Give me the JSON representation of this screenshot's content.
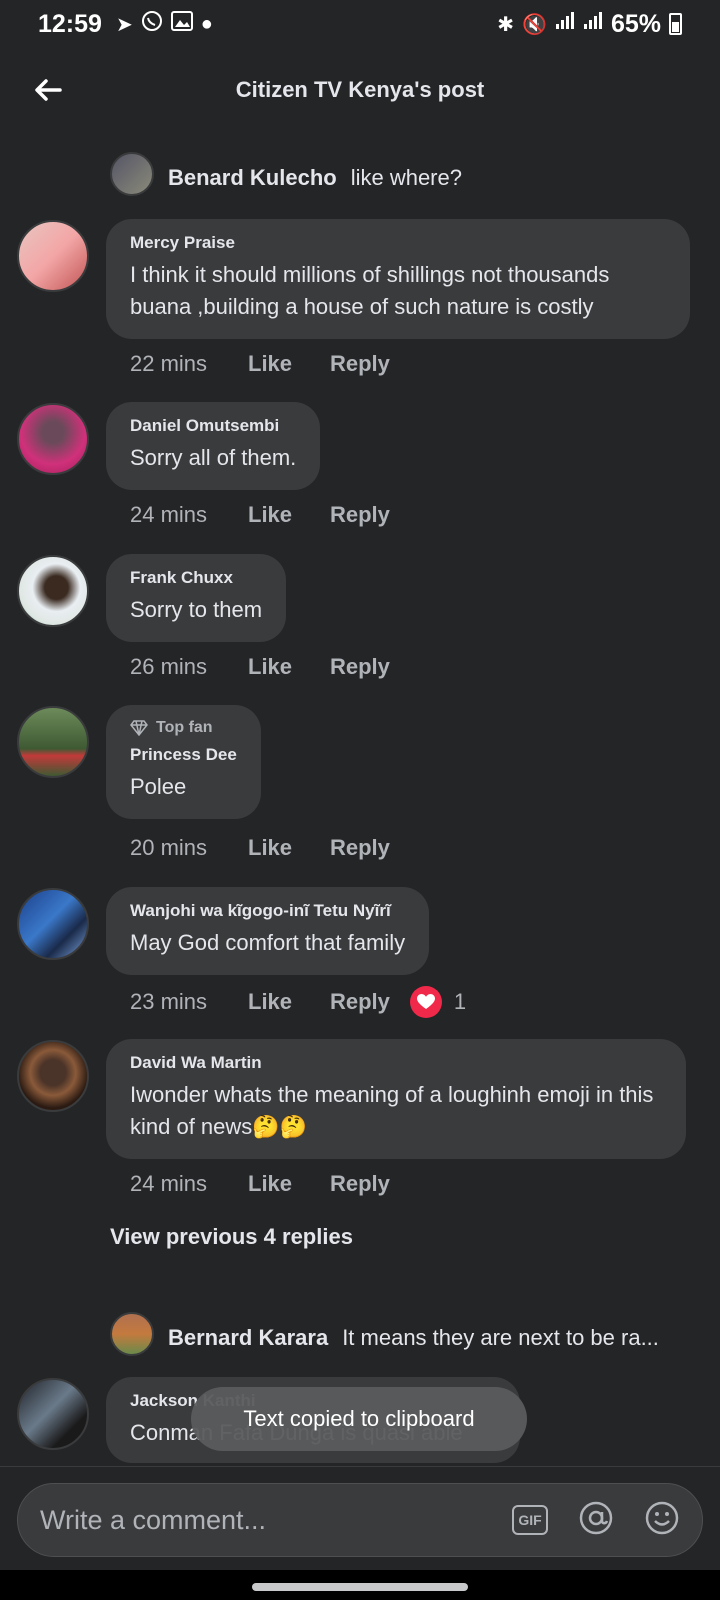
{
  "status_bar": {
    "time": "12:59",
    "battery": "65%"
  },
  "header": {
    "title": "Citizen TV Kenya's post"
  },
  "reply_top": {
    "name": "Benard Kulecho",
    "text": "like where?"
  },
  "comments": [
    {
      "author": "Mercy Praise",
      "text": "I think it should millions of shillings not thousands buana ,building a house of such nature  is costly",
      "time": "22 mins"
    },
    {
      "author": "Daniel Omutsembi",
      "text": "Sorry all of them.",
      "time": "24 mins"
    },
    {
      "author": "Frank Chuxx",
      "text": "Sorry to them",
      "time": "26 mins"
    },
    {
      "author": "Princess Dee",
      "badge": "Top fan",
      "text": "Polee",
      "time": "20 mins"
    },
    {
      "author": "Wanjohi wa kĩgogo-inĩ Tetu Nyĩrĩ",
      "text": "May God comfort that family",
      "time": "23 mins",
      "reaction_count": "1"
    },
    {
      "author": "David Wa Martin",
      "text": "Iwonder whats the meaning of a loughinh emoji in this kind of news🤔🤔",
      "time": "24 mins"
    },
    {
      "author": "Jackson Kanthi",
      "text": "Conman Fafa Dunga is quasi able"
    }
  ],
  "actions": {
    "like": "Like",
    "reply": "Reply"
  },
  "view_previous": "View previous 4 replies",
  "reply_bottom": {
    "name": "Bernard Karara",
    "text": "It means they are next to be ra..."
  },
  "toast": "Text copied to clipboard",
  "composer": {
    "placeholder": "Write a comment...",
    "gif_label": "GIF"
  },
  "colors": {
    "background": "#242526",
    "bubble": "#3a3b3c",
    "heart": "#f02849"
  }
}
